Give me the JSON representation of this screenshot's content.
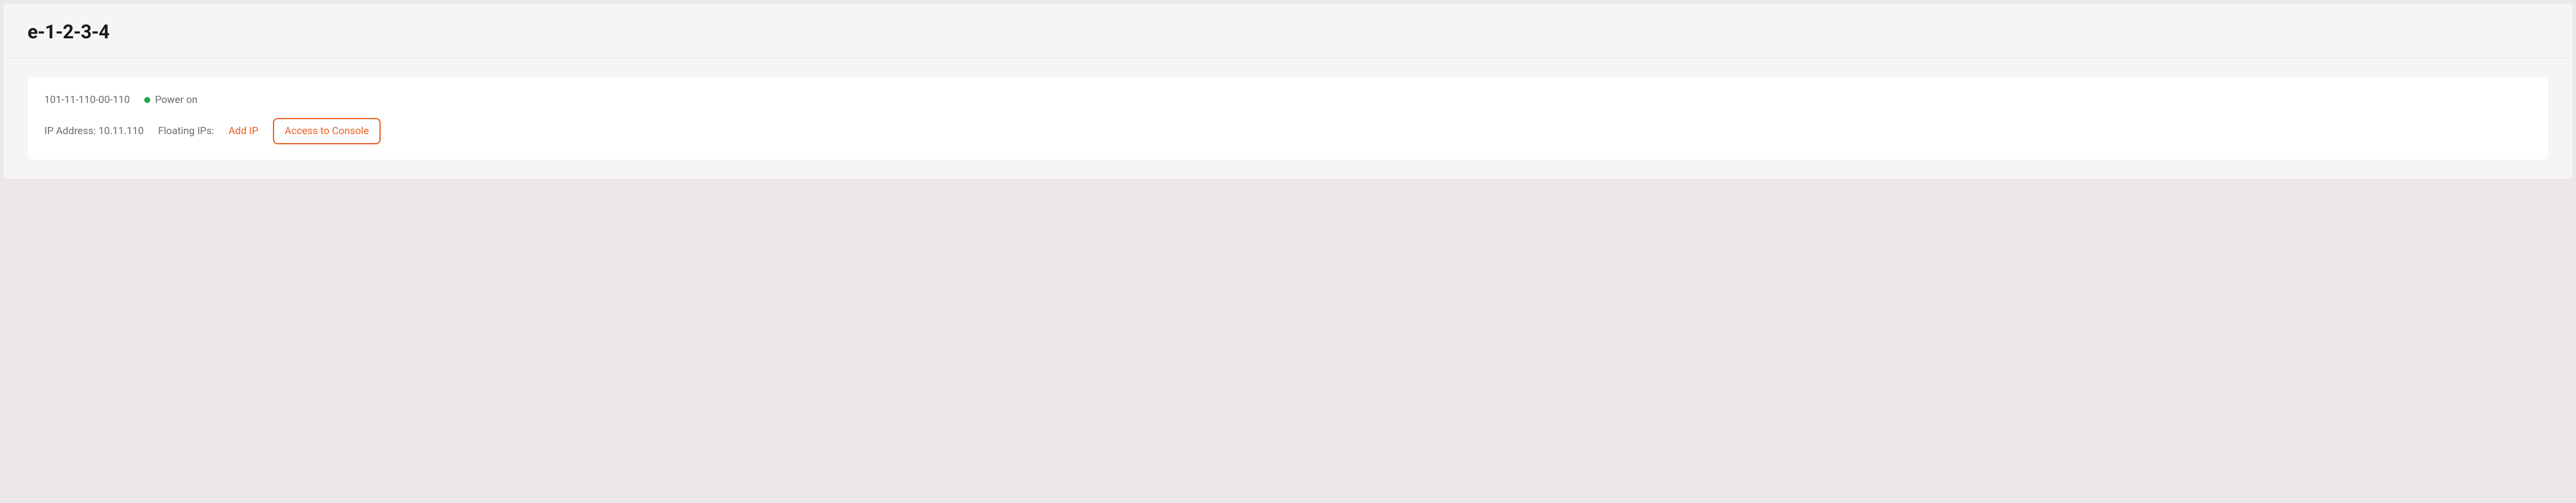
{
  "page": {
    "title": "e-1-2-3-4"
  },
  "server": {
    "id": "101-11-110-00-110",
    "status_text": "Power on",
    "status_color": "#1ea646",
    "ip_label": "IP Address: ",
    "ip_address": "10.11.110",
    "floating_ips_label": "Floating IPs:",
    "add_ip_label": "Add IP",
    "console_button": "Access to Console"
  },
  "colors": {
    "accent": "#e85d1f"
  }
}
